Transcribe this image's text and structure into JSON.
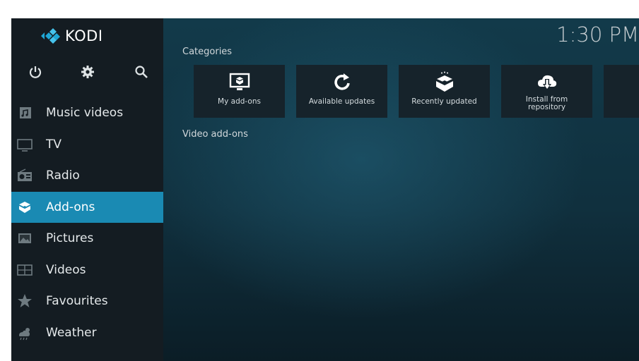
{
  "app": {
    "logo_text": "KODI"
  },
  "clock": {
    "time": "1:30 PM"
  },
  "top_controls": [
    "power-icon",
    "settings-icon",
    "search-icon"
  ],
  "menu": {
    "items": [
      {
        "label": "Music videos",
        "icon": "music-video-icon"
      },
      {
        "label": "TV",
        "icon": "tv-icon"
      },
      {
        "label": "Radio",
        "icon": "radio-icon"
      },
      {
        "label": "Add-ons",
        "icon": "addons-box-icon",
        "active": true
      },
      {
        "label": "Pictures",
        "icon": "pictures-icon"
      },
      {
        "label": "Videos",
        "icon": "videos-icon"
      },
      {
        "label": "Favourites",
        "icon": "star-icon"
      },
      {
        "label": "Weather",
        "icon": "weather-icon"
      }
    ]
  },
  "main": {
    "categories_title": "Categories",
    "tiles": [
      {
        "label": "My add-ons",
        "icon": "monitor-box-icon"
      },
      {
        "label": "Available updates",
        "icon": "refresh-icon"
      },
      {
        "label": "Recently updated",
        "icon": "open-box-icon"
      },
      {
        "label": "Install from repository",
        "icon": "cloud-download-icon"
      }
    ],
    "video_addons_title": "Video add-ons"
  },
  "colors": {
    "accent": "#1a8ab3",
    "sidebar": "#141c22",
    "tile": "#16232b"
  }
}
